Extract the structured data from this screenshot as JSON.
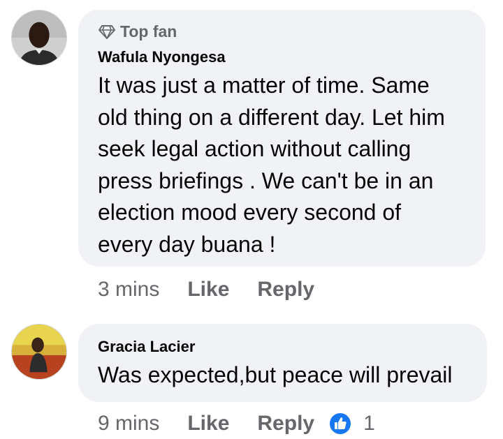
{
  "comments": [
    {
      "badge": "Top fan",
      "author": "Wafula Nyongesa",
      "text_lines": [
        "It was just a matter of time. Same",
        "old thing on a different day. Let him",
        "seek legal action without calling",
        "press briefings . We can't be in an",
        "election mood every second of",
        "every day buana !"
      ],
      "time": "3 mins",
      "like_label": "Like",
      "reply_label": "Reply"
    },
    {
      "author": "Gracia Lacier",
      "text": "Was expected,but peace will prevail",
      "time": "9 mins",
      "like_label": "Like",
      "reply_label": "Reply",
      "reaction_count": "1"
    }
  ],
  "colors": {
    "bubble": "#f0f2f5",
    "secondary_text": "#65676b",
    "primary_text": "#050505",
    "like_blue": "#1877f2"
  },
  "icons": [
    "diamond-icon",
    "like-reaction-icon"
  ]
}
